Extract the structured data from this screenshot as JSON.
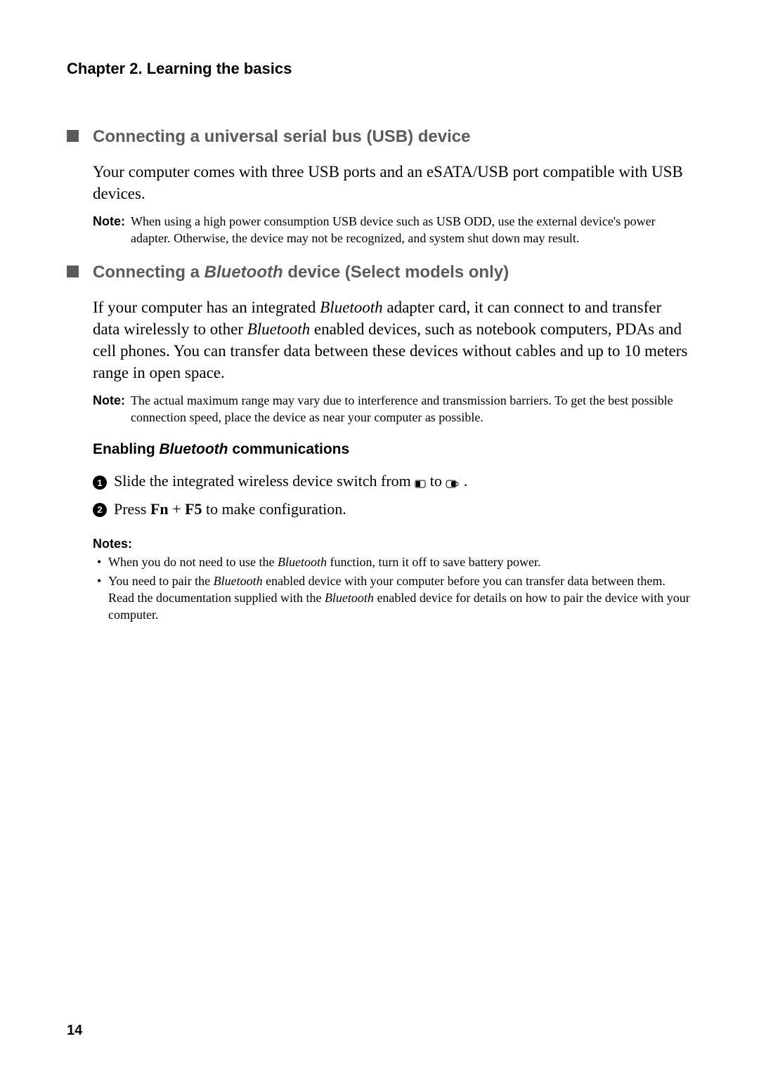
{
  "chapter_title": "Chapter 2. Learning the basics",
  "section1": {
    "title": "Connecting a universal serial bus (USB) device",
    "body": "Your computer comes with three USB ports and an eSATA/USB port compatible with USB devices.",
    "note_label": "Note:",
    "note_text": "When using a high power consumption USB device such as USB ODD, use the external device's power adapter. Otherwise, the device may not be recognized, and system shut down may result."
  },
  "section2": {
    "title_prefix": "Connecting a ",
    "title_italic": "Bluetooth",
    "title_suffix": " device (Select models only)",
    "body_part1": "If your computer has an integrated ",
    "body_italic1": "Bluetooth",
    "body_part2": " adapter card, it can connect to and transfer data wirelessly to other ",
    "body_italic2": "Bluetooth",
    "body_part3": " enabled devices, such as notebook computers, PDAs and cell phones. You can transfer data between these devices without cables and up to 10 meters range in open space.",
    "note_label": "Note:",
    "note_text": "The actual maximum range may vary due to interference and transmission barriers. To get the best possible connection speed, place the device as near your computer as possible."
  },
  "subsection": {
    "title_prefix": "Enabling ",
    "title_italic": "Bluetooth",
    "title_suffix": " communications",
    "step1_num": "1",
    "step1_prefix": "Slide the integrated wireless device switch from ",
    "step1_mid": " to ",
    "step1_suffix": " .",
    "step2_num": "2",
    "step2_prefix": "Press ",
    "step2_key1": "Fn",
    "step2_plus": " + ",
    "step2_key2": "F5",
    "step2_suffix": " to make configuration."
  },
  "notes": {
    "heading": "Notes:",
    "item1_prefix": "When you do not need to use the ",
    "item1_italic": "Bluetooth",
    "item1_suffix": " function, turn it off to save battery power.",
    "item2_prefix": "You need to pair the ",
    "item2_italic1": "Bluetooth",
    "item2_mid": " enabled device with your computer before you can transfer data between them. Read the documentation supplied with the ",
    "item2_italic2": "Bluetooth",
    "item2_suffix": " enabled device for details on how to pair the device with your computer."
  },
  "page_number": "14"
}
